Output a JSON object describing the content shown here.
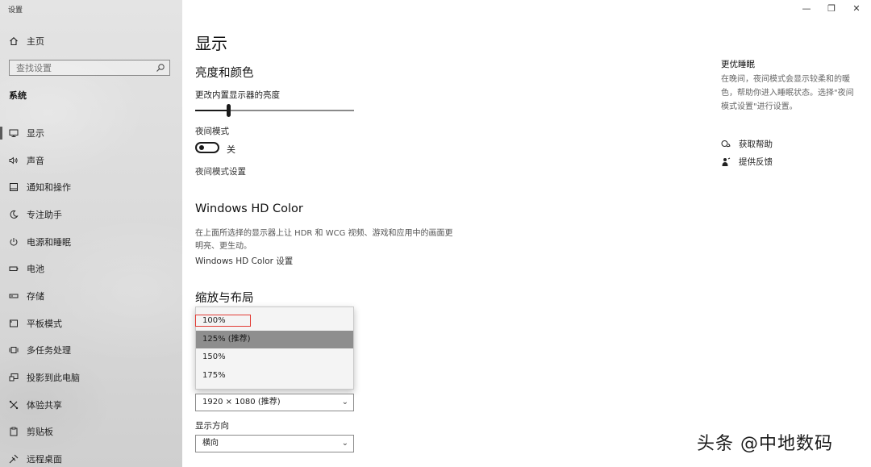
{
  "window": {
    "title": "设置",
    "controls": [
      "—",
      "❐",
      "✕"
    ]
  },
  "sidebar": {
    "home_label": "主页",
    "search_placeholder": "查找设置",
    "section_label": "系统",
    "items": [
      {
        "label": "显示",
        "icon": "monitor-icon",
        "active": true
      },
      {
        "label": "声音",
        "icon": "speaker-icon"
      },
      {
        "label": "通知和操作",
        "icon": "notification-icon"
      },
      {
        "label": "专注助手",
        "icon": "moon-icon"
      },
      {
        "label": "电源和睡眠",
        "icon": "power-icon"
      },
      {
        "label": "电池",
        "icon": "battery-icon"
      },
      {
        "label": "存储",
        "icon": "storage-icon"
      },
      {
        "label": "平板模式",
        "icon": "tablet-icon"
      },
      {
        "label": "多任务处理",
        "icon": "multitask-icon"
      },
      {
        "label": "投影到此电脑",
        "icon": "project-icon"
      },
      {
        "label": "体验共享",
        "icon": "share-icon"
      },
      {
        "label": "剪贴板",
        "icon": "clipboard-icon"
      },
      {
        "label": "远程桌面",
        "icon": "remote-desktop-icon"
      }
    ]
  },
  "main": {
    "title": "显示",
    "brightness": {
      "heading": "亮度和颜色",
      "slider_label": "更改内置显示器的亮度",
      "value_percent": 21
    },
    "night_light": {
      "label": "夜间模式",
      "toggle_state": "关",
      "settings_link": "夜间模式设置"
    },
    "hd_color": {
      "heading": "Windows HD Color",
      "desc": "在上面所选择的显示器上让 HDR 和 WCG 视频、游戏和应用中的画面更明亮、更生动。",
      "link": "Windows HD Color 设置"
    },
    "scale_layout": {
      "heading": "缩放与布局",
      "scale_options": [
        "100%",
        "125% (推荐)",
        "150%",
        "175%"
      ],
      "highlighted_option": "125% (推荐)",
      "boxed_option": "100%",
      "resolution_value": "1920 × 1080 (推荐)",
      "orientation_label": "显示方向",
      "orientation_value": "横向"
    }
  },
  "right_panel": {
    "title": "更优睡眠",
    "desc": "在晚间，夜间模式会显示较柔和的暖色，帮助你进入睡眠状态。选择\"夜间模式设置\"进行设置。",
    "help_link": "获取帮助",
    "feedback_link": "提供反馈"
  },
  "watermark": "头条 @中地数码",
  "colors": {
    "highlight_box": "#e23a33",
    "selected_option_bg": "#8e8e8e",
    "sidebar_bg": "#dcdcdc"
  }
}
